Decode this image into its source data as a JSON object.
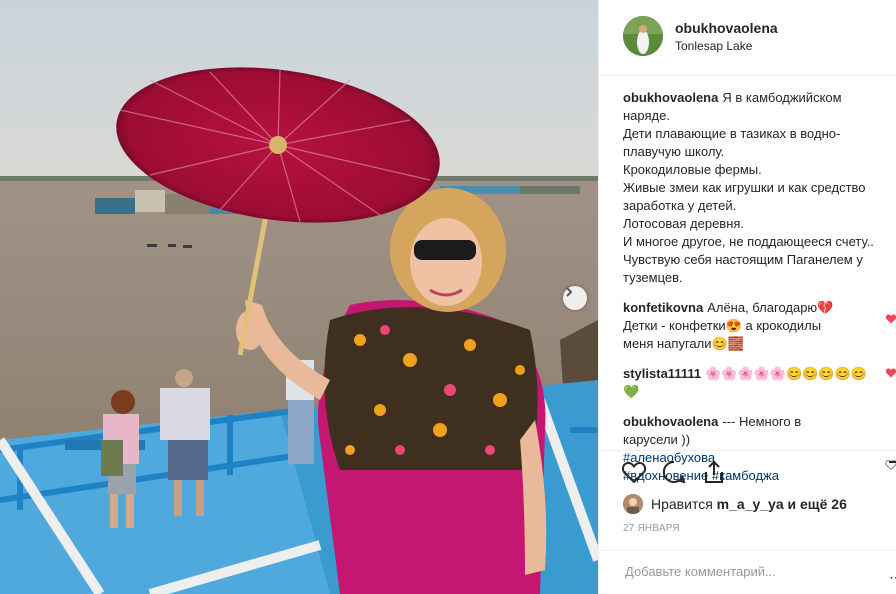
{
  "post": {
    "username": "obukhovaolena",
    "location": "Tonlesap Lake"
  },
  "comments": [
    {
      "author": "obukhovaolena",
      "lines": [
        "Я в камбоджийском",
        "наряде.",
        "Дети плавающие в тазиках в водно-",
        "плавучую школу.",
        "Крокодиловые фермы.",
        "Живые змеи как игрушки и как средство",
        "заработка у детей.",
        "Лотосовая деревня.",
        "И многое другое, не поддающееся счету..",
        "Чувствую себя настоящим Паганелем у",
        "туземцев."
      ]
    },
    {
      "author": "konfetikovna",
      "lines": [
        "Алёна, благодарю💔",
        "Детки - конфетки😍 а крокодилы",
        "меня напугали😊🧱"
      ]
    },
    {
      "author": "stylista11111",
      "lines": [
        "🌸🌸🌸🌸🌸😊😊😊😊😊💚"
      ]
    },
    {
      "author": "obukhovaolena",
      "lines": [
        "--- Немного в",
        "карусели ))"
      ],
      "hashtags": [
        "#аленаобухова",
        "#вдохновение",
        "#камбоджа"
      ]
    }
  ],
  "likes": {
    "prefix": "Нравится",
    "user": "m_a_y_ya",
    "suffix": "и ещё 26"
  },
  "date": "27 ЯНВАРЯ",
  "add_comment_placeholder": "Добавьте комментарий...",
  "icons": {
    "like": "heart-icon",
    "comment": "comment-icon",
    "share": "share-icon",
    "save": "bookmark-icon",
    "next": "chevron-right-icon"
  },
  "colors": {
    "heart_red": "#ed4956",
    "hashtag_blue": "#003569",
    "border": "#efefef"
  }
}
